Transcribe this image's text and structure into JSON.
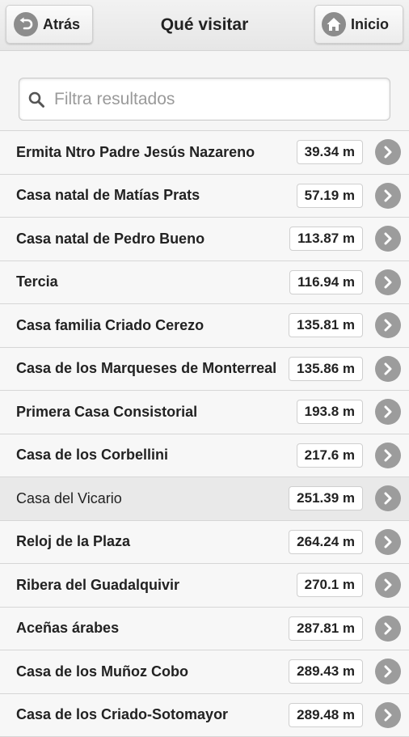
{
  "header": {
    "title": "Qué visitar",
    "back_label": "Atrás",
    "home_label": "Inicio"
  },
  "search": {
    "placeholder": "Filtra resultados",
    "value": ""
  },
  "items": [
    {
      "name": "Ermita Ntro Padre Jesús Nazareno",
      "distance": "39.34 m"
    },
    {
      "name": "Casa natal de Matías Prats",
      "distance": "57.19 m"
    },
    {
      "name": "Casa natal de Pedro Bueno",
      "distance": "113.87 m"
    },
    {
      "name": "Tercia",
      "distance": "116.94 m"
    },
    {
      "name": "Casa familia Criado Cerezo",
      "distance": "135.81 m"
    },
    {
      "name": "Casa de los Marqueses de Monterreal",
      "distance": "135.86 m"
    },
    {
      "name": "Primera Casa Consistorial",
      "distance": "193.8 m"
    },
    {
      "name": "Casa de los Corbellini",
      "distance": "217.6 m"
    },
    {
      "name": "Casa del Vicario",
      "distance": "251.39 m"
    },
    {
      "name": "Reloj de la Plaza",
      "distance": "264.24 m"
    },
    {
      "name": "Ribera del Guadalquivir",
      "distance": "270.1 m"
    },
    {
      "name": "Aceñas árabes",
      "distance": "287.81 m"
    },
    {
      "name": "Casa de los Muñoz Cobo",
      "distance": "289.43 m"
    },
    {
      "name": "Casa de los Criado-Sotomayor",
      "distance": "289.48 m"
    }
  ],
  "icons": {
    "back": "back-arrow-icon",
    "home": "home-icon",
    "search": "search-icon",
    "row": "chevron-right-icon"
  }
}
